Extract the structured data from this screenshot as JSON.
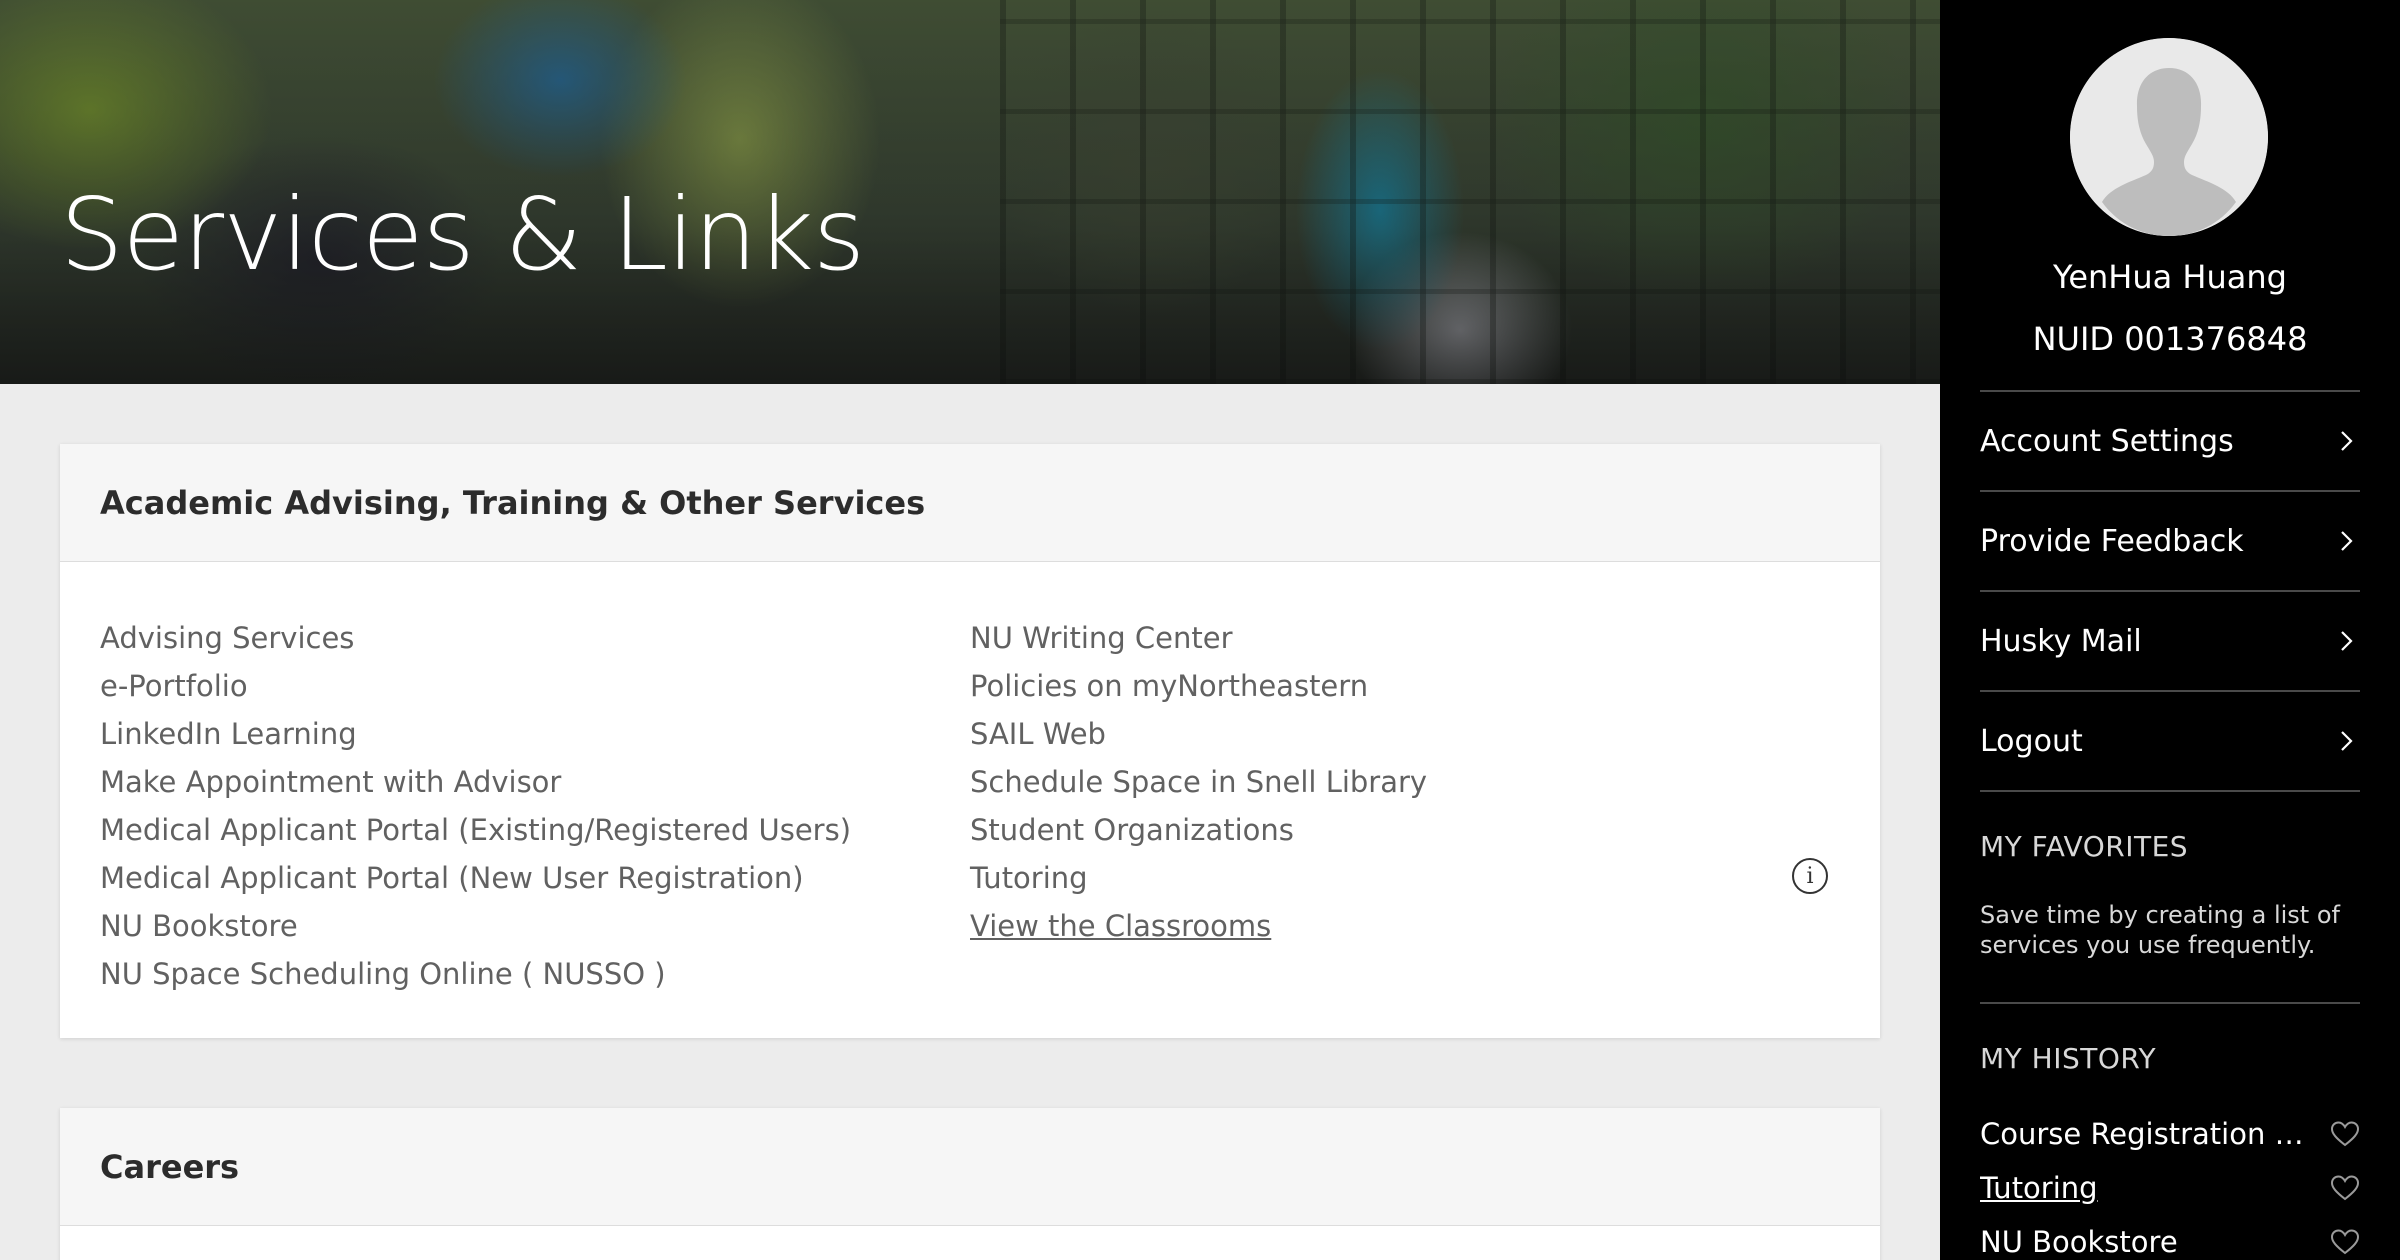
{
  "hero": {
    "title": "Services & Links"
  },
  "cards": [
    {
      "title": "Academic Advising, Training & Other Services",
      "left_links": [
        "Advising Services",
        "e-Portfolio",
        "LinkedIn Learning",
        "Make Appointment with Advisor",
        "Medical Applicant Portal (Existing/Registered Users)",
        "Medical Applicant Portal (New User Registration)",
        "NU Bookstore",
        "NU Space Scheduling Online ( NUSSO )"
      ],
      "right_links": [
        "NU Writing Center",
        "Policies on myNortheastern",
        "SAIL Web",
        "Schedule Space in Snell Library",
        "Student Organizations",
        "Tutoring",
        "View the Classrooms"
      ]
    },
    {
      "title": "Careers"
    }
  ],
  "sidebar": {
    "user_name": "YenHua Huang",
    "nuid": "NUID 001376848",
    "menu": [
      "Account Settings",
      "Provide Feedback",
      "Husky Mail",
      "Logout"
    ],
    "favorites_label": "MY FAVORITES",
    "favorites_text": "Save time by creating a list of services you use frequently.",
    "history_label": "MY HISTORY",
    "history": [
      "Course Registration (NEW)",
      "Tutoring",
      "NU Bookstore"
    ]
  },
  "icons": {
    "menu_chevron": "chevron-right-icon",
    "info": "info-icon",
    "favorite": "heart-icon",
    "avatar": "user-avatar-placeholder"
  },
  "colors": {
    "sidebar_bg": "#000000",
    "page_bg": "#ececec",
    "card_header_bg": "#f6f6f6",
    "link_text": "#616161"
  }
}
